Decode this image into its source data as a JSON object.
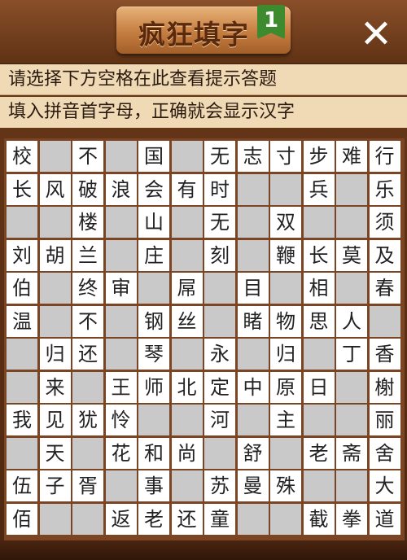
{
  "header": {
    "title": "疯狂填字",
    "level": "1",
    "close_label": "✕"
  },
  "hints": {
    "line1": "请选择下方空格在此查看提示答题",
    "line2": "填入拼音首字母，正确就会显示汉字"
  },
  "colors": {
    "board_frame": "#7b4523",
    "header": "#6b3a1c",
    "hint_bg": "#f0d9b5",
    "blank_cell": "#c9c9c9",
    "letter_cell": "#ffffff",
    "level_badge": "#3e8a2e"
  },
  "board": {
    "rows": [
      [
        "校",
        null,
        "不",
        null,
        "国",
        null,
        "无",
        "志",
        "寸",
        "步",
        "难",
        "行"
      ],
      [
        "长",
        "风",
        "破",
        "浪",
        "会",
        "有",
        "时",
        null,
        null,
        "兵",
        null,
        "乐"
      ],
      [
        null,
        null,
        "楼",
        null,
        "山",
        null,
        "无",
        null,
        "双",
        null,
        null,
        "须"
      ],
      [
        "刘",
        "胡",
        "兰",
        null,
        "庄",
        null,
        "刻",
        null,
        "鞭",
        "长",
        "莫",
        "及"
      ],
      [
        "伯",
        null,
        "终",
        "审",
        null,
        "屌",
        null,
        "目",
        null,
        "相",
        null,
        "春"
      ],
      [
        "温",
        null,
        "不",
        null,
        "钢",
        "丝",
        null,
        "睹",
        "物",
        "思",
        "人",
        null
      ],
      [
        null,
        "归",
        "还",
        null,
        "琴",
        null,
        "永",
        null,
        "归",
        null,
        "丁",
        "香"
      ],
      [
        null,
        "来",
        null,
        "王",
        "师",
        "北",
        "定",
        "中",
        "原",
        "日",
        null,
        "榭"
      ],
      [
        "我",
        "见",
        "犹",
        "怜",
        null,
        null,
        "河",
        null,
        "主",
        null,
        null,
        "丽"
      ],
      [
        null,
        "天",
        null,
        "花",
        "和",
        "尚",
        null,
        "舒",
        null,
        "老",
        "斋",
        "舍"
      ],
      [
        "伍",
        "子",
        "胥",
        null,
        "事",
        null,
        "苏",
        "曼",
        "殊",
        null,
        null,
        "大"
      ],
      [
        "佰",
        null,
        null,
        "返",
        "老",
        "还",
        "童",
        null,
        null,
        "截",
        "拳",
        "道"
      ]
    ]
  }
}
